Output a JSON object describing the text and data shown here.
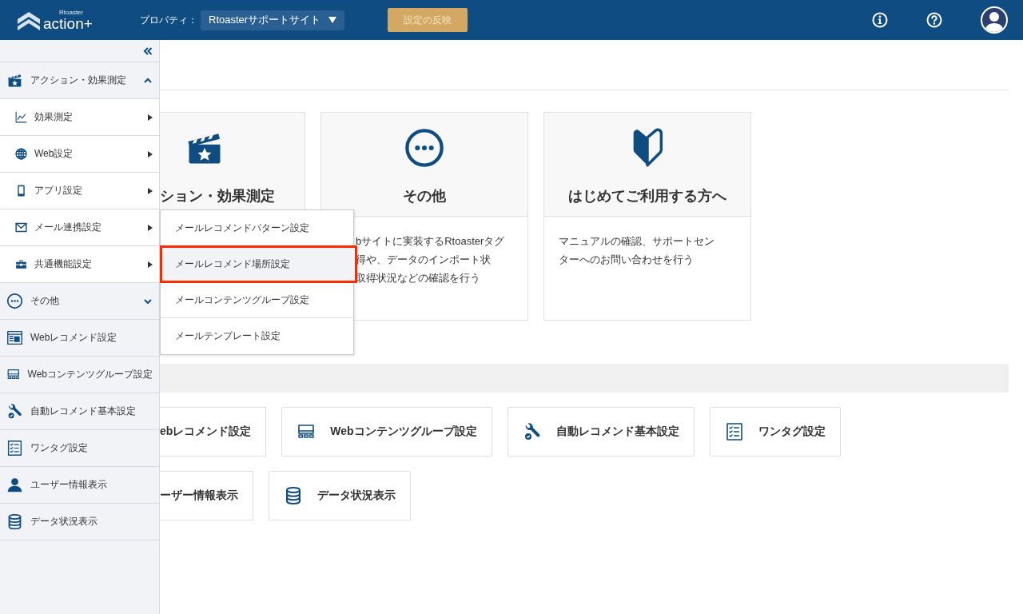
{
  "header": {
    "logo_small": "Rtoaster",
    "logo": "action+",
    "property_label": "プロパティ：",
    "property_value": "Rtoasterサポートサイト",
    "apply_button": "設定の反映"
  },
  "sidebar": {
    "items": [
      {
        "kind": "group",
        "label": "アクション・効果測定",
        "expanded": true,
        "children": [
          {
            "label": "効果測定"
          },
          {
            "label": "Web設定"
          },
          {
            "label": "アプリ設定"
          },
          {
            "label": "メール連携設定"
          },
          {
            "label": "共通機能設定"
          }
        ]
      },
      {
        "kind": "group",
        "label": "その他",
        "expanded": false
      },
      {
        "kind": "link",
        "label": "Webレコメンド設定"
      },
      {
        "kind": "link",
        "label": "Webコンテンツグループ設定"
      },
      {
        "kind": "link",
        "label": "自動レコメンド基本設定"
      },
      {
        "kind": "link",
        "label": "ワンタグ設定"
      },
      {
        "kind": "link",
        "label": "ユーザー情報表示"
      },
      {
        "kind": "link",
        "label": "データ状況表示"
      }
    ]
  },
  "submenu": {
    "items": [
      {
        "label": "メールレコメンドパターン設定",
        "selected": false
      },
      {
        "label": "メールレコメンド場所設定",
        "selected": true
      },
      {
        "label": "メールコンテンツグループ設定",
        "selected": false
      },
      {
        "label": "メールテンプレート設定",
        "selected": false
      }
    ]
  },
  "cards": [
    {
      "title": "ション・効果測定"
    },
    {
      "title": "その他",
      "description": [
        "bサイトに実装するRtoasterタグ",
        "得や、データのインポート状",
        "取得状況などの確認を行う"
      ]
    },
    {
      "title": "はじめてご利用する方へ",
      "description": [
        "マニュアルの確認、サポートセン",
        "ターへのお問い合わせを行う"
      ]
    }
  ],
  "shortcuts": [
    [
      {
        "label": "ebレコメンド設定"
      },
      {
        "label": "Webコンテンツグループ設定"
      },
      {
        "label": "自動レコメンド基本設定"
      },
      {
        "label": "ワンタグ設定"
      }
    ],
    [
      {
        "label": "ーザー情報表示"
      },
      {
        "label": "データ状況表示"
      }
    ]
  ]
}
